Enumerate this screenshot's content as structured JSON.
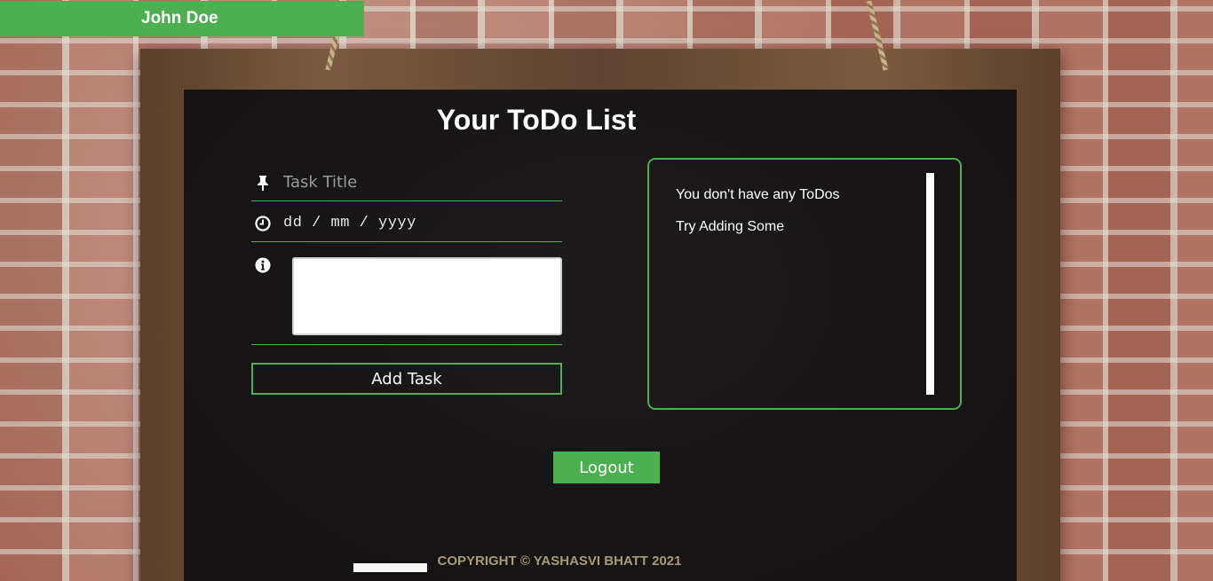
{
  "user": {
    "name": "John Doe"
  },
  "page": {
    "title": "Your ToDo List"
  },
  "form": {
    "title_placeholder": "Task Title",
    "date_placeholder": "dd / mm / yyyy",
    "description_value": "",
    "add_button_label": "Add Task"
  },
  "todos": {
    "empty_message_1": "You don't have any ToDos",
    "empty_message_2": "Try Adding Some",
    "items": []
  },
  "logout": {
    "label": "Logout"
  },
  "footer": {
    "copyright": "COPYRIGHT © YASHASVI BHATT 2021"
  },
  "icons": {
    "title_field": "pushpin-icon",
    "date_field": "clock-icon",
    "description_field": "info-icon"
  },
  "colors": {
    "accent": "#4caf50",
    "board": "#171515",
    "footer_text": "#a89a76"
  }
}
